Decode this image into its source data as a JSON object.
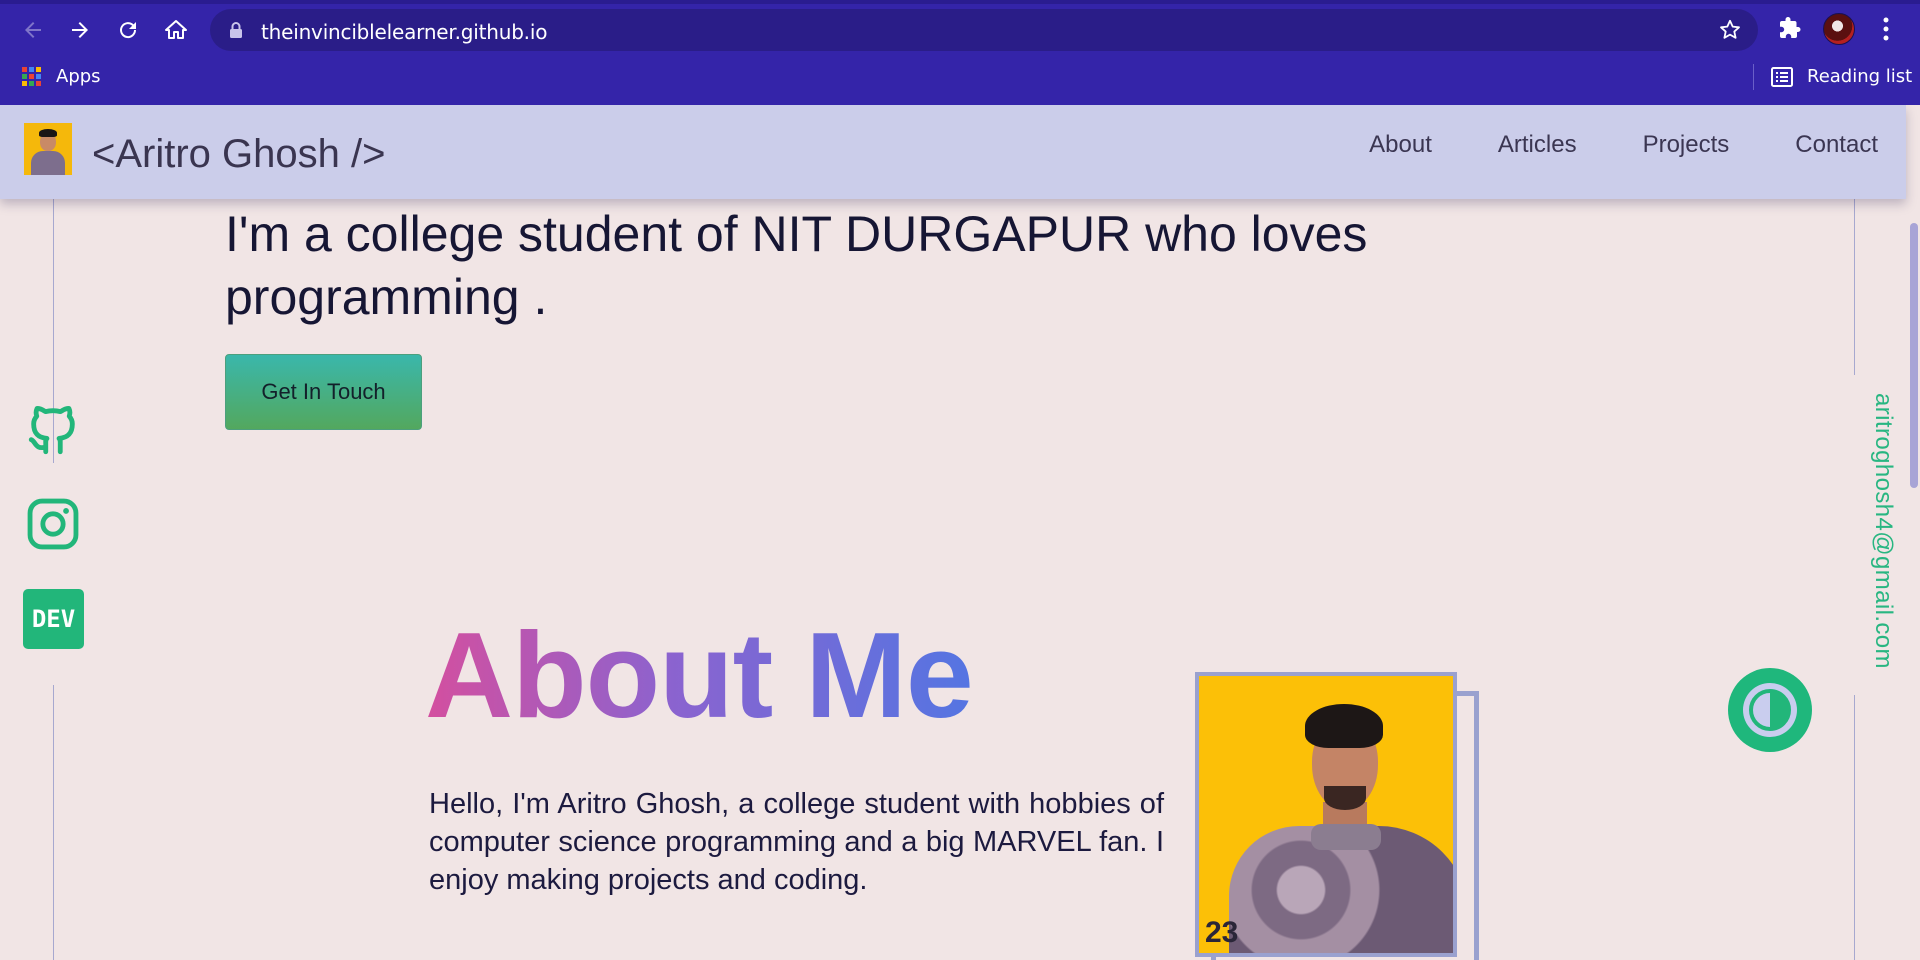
{
  "browser": {
    "url": "theinvinciblelearner.github.io",
    "bookmarks": {
      "apps_label": "Apps",
      "reading_list_label": "Reading list"
    }
  },
  "site": {
    "brand": "<Aritro Ghosh />",
    "nav": [
      "About",
      "Articles",
      "Projects",
      "Contact"
    ],
    "intro": "I'm a college student of NIT DURGAPUR who loves programming .",
    "cta_label": "Get In Touch",
    "dev_label": "DEV",
    "email": "aritroghosh4@gmail.com",
    "about": {
      "title": "About Me",
      "text": "Hello, I'm Aritro Ghosh, a college student with hobbies of computer science programming and a big MARVEL fan. I enjoy making projects and coding."
    }
  },
  "colors": {
    "chrome": "#3424a9",
    "page_bg": "#f1e5e5",
    "accent_green": "#22b67a",
    "title_gradient": [
      "#d44f9f",
      "#8b63cf",
      "#5475e2"
    ]
  },
  "icons": [
    "back-icon",
    "forward-icon",
    "reload-icon",
    "home-icon",
    "lock-icon",
    "star-icon",
    "extensions-icon",
    "menu-icon",
    "apps-icon",
    "reading-list-icon",
    "github-icon",
    "instagram-icon",
    "theme-toggle-icon"
  ]
}
